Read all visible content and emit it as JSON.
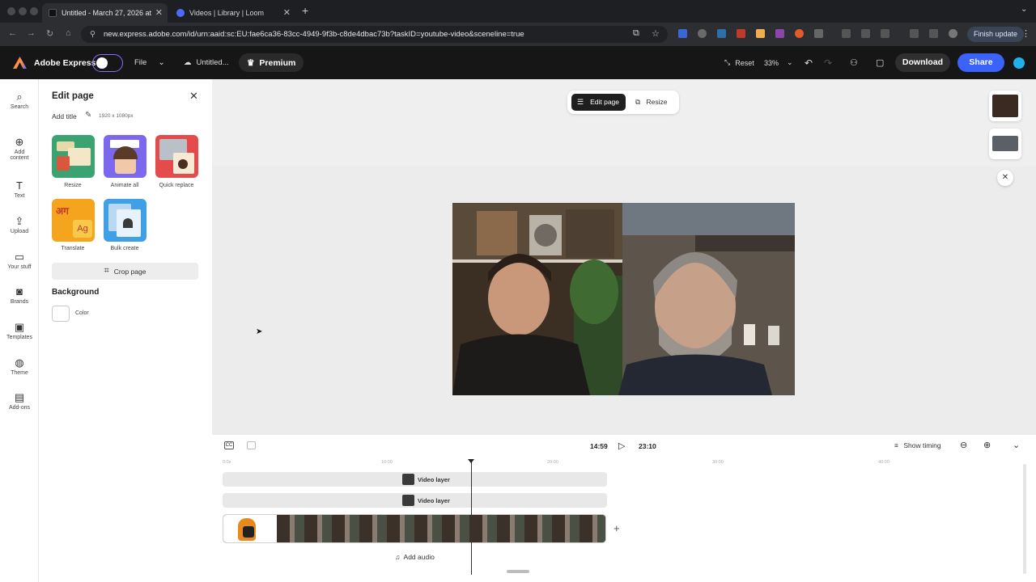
{
  "browser": {
    "tabs": [
      {
        "title": "Untitled - March 27, 2026 at",
        "active": true
      },
      {
        "title": "Videos | Library | Loom",
        "active": false
      }
    ],
    "new_tab": "+",
    "url": "new.express.adobe.com/id/urn:aaid:sc:EU:fae6ca36-83cc-4949-9f3b-c8de4dbac73b?taskID=youtube-video&sceneline=true",
    "finish_update": "Finish update"
  },
  "header": {
    "app_name": "Adobe Express",
    "file_menu": "File",
    "doc_name": "Untitled...",
    "premium": "Premium",
    "reset": "Reset",
    "zoom": "33%",
    "download": "Download",
    "share": "Share"
  },
  "rail": {
    "items": [
      {
        "label": "Search",
        "icon": "⌕"
      },
      {
        "label": "Add content",
        "icon": "⊕"
      },
      {
        "label": "Text",
        "icon": "T"
      },
      {
        "label": "Upload",
        "icon": "⇪"
      },
      {
        "label": "Your stuff",
        "icon": "▭"
      },
      {
        "label": "Brands",
        "icon": "◙"
      },
      {
        "label": "Templates",
        "icon": "▣"
      },
      {
        "label": "Theme",
        "icon": "◍"
      },
      {
        "label": "Add-ons",
        "icon": "▤"
      }
    ]
  },
  "panel": {
    "title": "Edit page",
    "add_title": "Add title",
    "dimensions": "1920 x 1080px",
    "tiles": [
      {
        "label": "Resize"
      },
      {
        "label": "Animate all"
      },
      {
        "label": "Quick replace"
      },
      {
        "label": "Translate"
      },
      {
        "label": "Bulk create"
      }
    ],
    "crop_page": "Crop page",
    "background_heading": "Background",
    "color_label": "Color"
  },
  "canvas": {
    "edit_page": "Edit page",
    "resize": "Resize"
  },
  "timeline": {
    "current_time": "14:59",
    "total_time": "23:10",
    "show_timing": "Show timing",
    "layers": [
      "Video layer",
      "Video layer"
    ],
    "add_audio": "Add audio",
    "ruler": [
      "0:0s",
      "10:00",
      "20:00",
      "30:00",
      "40:00"
    ]
  },
  "colors": {
    "accent": "#3b63fb",
    "header_bg": "#161616"
  }
}
